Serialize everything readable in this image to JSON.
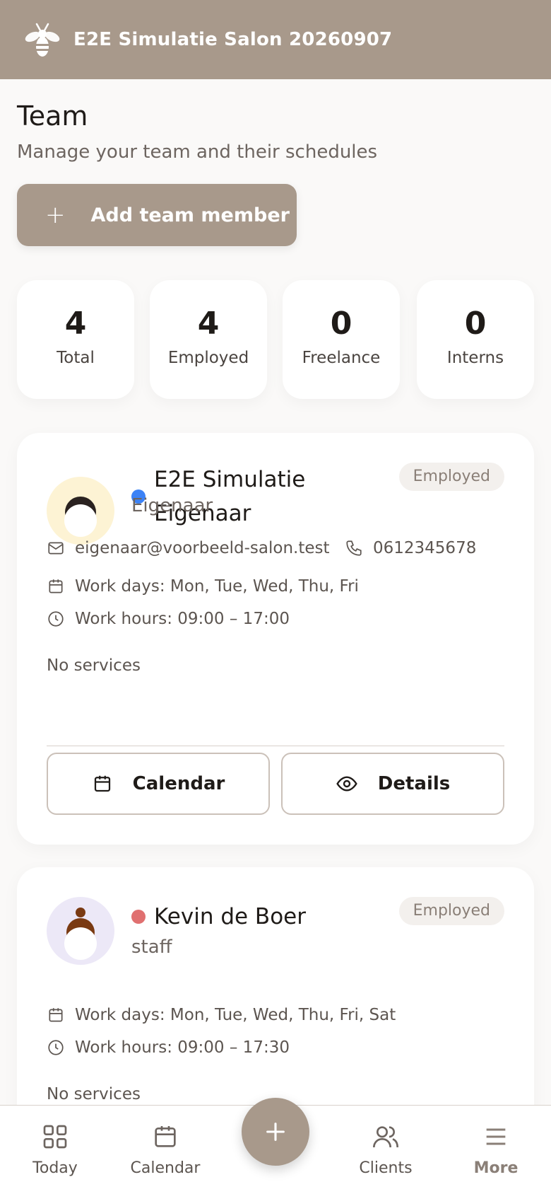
{
  "header": {
    "title": "E2E Simulatie Salon 20260907",
    "logo_icon": "bee-icon"
  },
  "page": {
    "title": "Team",
    "subtitle": "Manage your team and their schedules",
    "add_button": "Add team member"
  },
  "stats": [
    {
      "value": "4",
      "label": "Total"
    },
    {
      "value": "4",
      "label": "Employed"
    },
    {
      "value": "0",
      "label": "Freelance"
    },
    {
      "value": "0",
      "label": "Interns"
    }
  ],
  "members": [
    {
      "name_line1": "E2E Simulatie",
      "name_line2": "Eigenaar",
      "role": "Eigenaar",
      "badge": "Employed",
      "status_color": "#3b82f6",
      "avatar_bg": "#fdf3d4",
      "hair_color": "#2a2220",
      "email": "eigenaar@voorbeeld-salon.test",
      "phone": "0612345678",
      "work_days": "Work days: Mon, Tue, Wed, Thu, Fri",
      "work_hours": "Work hours: 09:00 – 17:00",
      "services": "No services",
      "calendar_label": "Calendar",
      "details_label": "Details"
    },
    {
      "name": "Kevin de Boer",
      "role": "staff",
      "badge": "Employed",
      "status_color": "#e07070",
      "avatar_bg": "#ece8f7",
      "hair_color": "#7a3a12",
      "work_days": "Work days: Mon, Tue, Wed, Thu, Fri, Sat",
      "work_hours": "Work hours: 09:00 – 17:30",
      "services": "No services"
    }
  ],
  "nav": {
    "today": "Today",
    "calendar": "Calendar",
    "clients": "Clients",
    "more": "More"
  },
  "colors": {
    "brand": "#a8998b",
    "text": "#1f1b18",
    "muted": "#6d6560"
  }
}
